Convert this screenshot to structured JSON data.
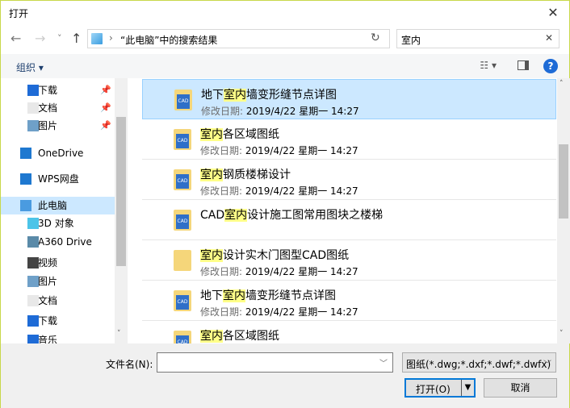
{
  "window": {
    "title": "打开",
    "close": "✕"
  },
  "nav": {
    "back": "←",
    "forward": "→",
    "recent": "˅",
    "up": "↑",
    "address": "“此电脑”中的搜索结果",
    "refresh": "↻",
    "search_value": "室内",
    "search_clear": "✕"
  },
  "toolbar": {
    "organize": "组织 ▾",
    "views": "☷ ▾",
    "help": "?"
  },
  "sidebar": {
    "items": [
      {
        "label": "下载",
        "icon": "download-icon",
        "pinned": true
      },
      {
        "label": "文档",
        "icon": "document-icon",
        "pinned": true
      },
      {
        "label": "图片",
        "icon": "pictures-icon",
        "pinned": true
      },
      {
        "label": "OneDrive",
        "icon": "cloud-icon"
      },
      {
        "label": "WPS网盘",
        "icon": "cloud-icon"
      },
      {
        "label": "此电脑",
        "icon": "computer-icon",
        "selected": true
      },
      {
        "label": "3D 对象",
        "icon": "3d-objects-icon"
      },
      {
        "label": "A360 Drive",
        "icon": "drive-icon"
      },
      {
        "label": "视频",
        "icon": "video-icon"
      },
      {
        "label": "图片",
        "icon": "pictures-icon"
      },
      {
        "label": "文档",
        "icon": "document-icon"
      },
      {
        "label": "下载",
        "icon": "download-icon"
      },
      {
        "label": "音乐",
        "icon": "music-icon"
      }
    ],
    "pin": "📌"
  },
  "files": {
    "meta_label": "修改日期:",
    "items": [
      {
        "pre": "地下",
        "hl": "室内",
        "post": "墙变形缝节点详图",
        "date": "2019/4/22 星期一 14:27",
        "cad": true,
        "selected": true
      },
      {
        "pre": "",
        "hl": "室内",
        "post": "各区域图纸",
        "date": "2019/4/22 星期一 14:27",
        "cad": true
      },
      {
        "pre": "",
        "hl": "室内",
        "post": "钢质楼梯设计",
        "date": "2019/4/22 星期一 14:27",
        "cad": true
      },
      {
        "pre": "CAD",
        "hl": "室内",
        "post": "设计施工图常用图块之楼梯",
        "date": "",
        "cad": true
      },
      {
        "pre": "",
        "hl": "室内",
        "post": "设计实木门图型CAD图纸",
        "date": "2019/4/22 星期一 14:27",
        "cad": false
      },
      {
        "pre": "地下",
        "hl": "室内",
        "post": "墙变形缝节点详图",
        "date": "2019/4/22 星期一 14:27",
        "cad": true
      },
      {
        "pre": "",
        "hl": "室内",
        "post": "各区域图纸",
        "date": "",
        "cad": true
      }
    ]
  },
  "bottom": {
    "filename_label": "文件名(N):",
    "filename_value": "",
    "filetype": "图纸(*.dwg;*.dxf;*.dwf;*.dwfx)",
    "open": "打开(O)",
    "cancel": "取消"
  },
  "colors": {
    "selection": "#cce8ff",
    "highlight": "#ffff88",
    "accent": "#0078d7"
  }
}
